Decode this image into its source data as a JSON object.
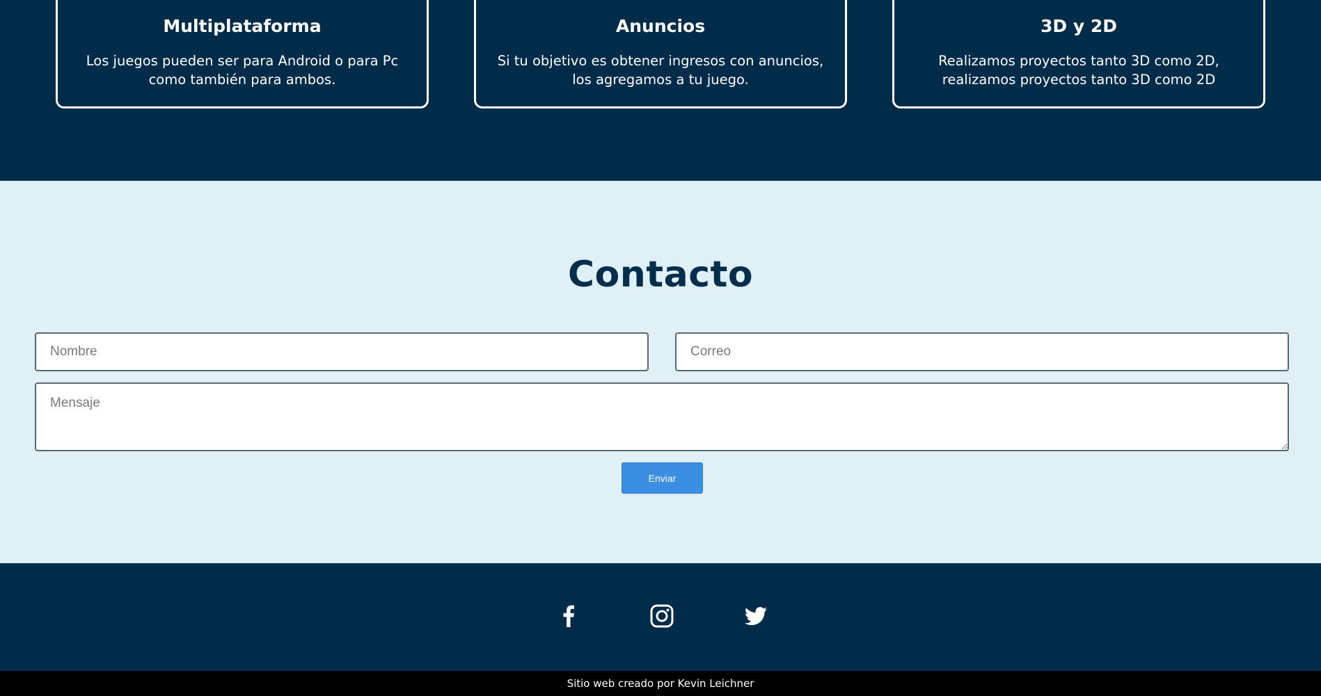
{
  "features": {
    "cards": [
      {
        "title": "Multiplataforma",
        "text": "Los juegos pueden ser para Android o para Pc como también para ambos."
      },
      {
        "title": "Anuncios",
        "text": "Si tu objetivo es obtener ingresos con anuncios, los agregamos a tu juego."
      },
      {
        "title": "3D y 2D",
        "text": "Realizamos proyectos tanto 3D como 2D, realizamos proyectos tanto 3D como 2D"
      }
    ]
  },
  "contact": {
    "title": "Contacto",
    "name_placeholder": "Nombre",
    "email_placeholder": "Correo",
    "message_placeholder": "Mensaje",
    "send_label": "Enviar"
  },
  "footer": {
    "socials": [
      {
        "icon": "facebook-icon"
      },
      {
        "icon": "instagram-icon"
      },
      {
        "icon": "twitter-icon"
      }
    ],
    "credit": "Sitio web creado por Kevin Leichner"
  },
  "colors": {
    "navy": "#002c4a",
    "light_blue": "#dff0f7",
    "button_blue": "#3b8fe3",
    "credit_bar": "#000000"
  }
}
